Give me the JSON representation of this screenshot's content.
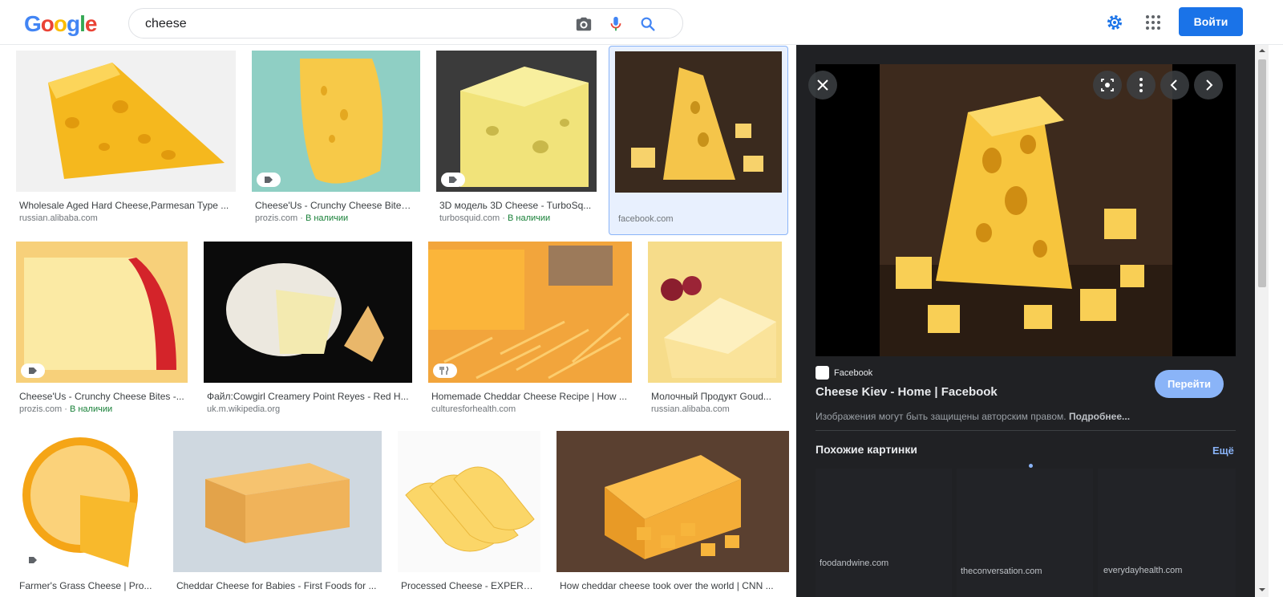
{
  "header": {
    "logo_letters": [
      "G",
      "o",
      "o",
      "g",
      "l",
      "e"
    ],
    "search_value": "cheese",
    "login_label": "Войти"
  },
  "results": [
    {
      "title": "Wholesale Aged Hard Cheese,Parmesan Type ...",
      "source": "russian.alibaba.com",
      "availability": ""
    },
    {
      "title": "Cheese'Us - Crunchy Cheese Bites ...",
      "source": "prozis.com",
      "availability": "В наличии"
    },
    {
      "title": "3D модель 3D Cheese - TurboSq...",
      "source": "turbosquid.com",
      "availability": "В наличии"
    },
    {
      "title": "",
      "source": "facebook.com",
      "availability": ""
    },
    {
      "title": "Cheese'Us - Crunchy Cheese Bites -...",
      "source": "prozis.com",
      "availability": "В наличии"
    },
    {
      "title": "Файл:Cowgirl Creamery Point Reyes - Red H...",
      "source": "uk.m.wikipedia.org",
      "availability": ""
    },
    {
      "title": "Homemade Cheddar Cheese Recipe | How ...",
      "source": "culturesforhealth.com",
      "availability": ""
    },
    {
      "title": "Молочный Продукт Goud...",
      "source": "russian.alibaba.com",
      "availability": ""
    },
    {
      "title": "Farmer's Grass Cheese | Pro...",
      "source": "",
      "availability": ""
    },
    {
      "title": "Cheddar Cheese for Babies - First Foods for ...",
      "source": "",
      "availability": ""
    },
    {
      "title": "Processed Cheese - EXPERR...",
      "source": "",
      "availability": ""
    },
    {
      "title": "How cheddar cheese took over the world | CNN ...",
      "source": "",
      "availability": ""
    }
  ],
  "availability_separator": " · ",
  "panel": {
    "site_name": "Facebook",
    "title": "Cheese Kiev - Home | Facebook",
    "visit_label": "Перейти",
    "copyright_text": "Изображения могут быть защищены авторским правом.",
    "more_link": "Подробнее...",
    "related_heading": "Похожие картинки",
    "more_related": "Ещё",
    "related_sources": [
      "foodandwine.com",
      "theconversation.com",
      "everydayhealth.com"
    ]
  },
  "colors": {
    "accent": "#1a73e8",
    "panel_bg": "#202124",
    "availability_green": "#188038",
    "cheese_yellow": "#f7c948"
  }
}
